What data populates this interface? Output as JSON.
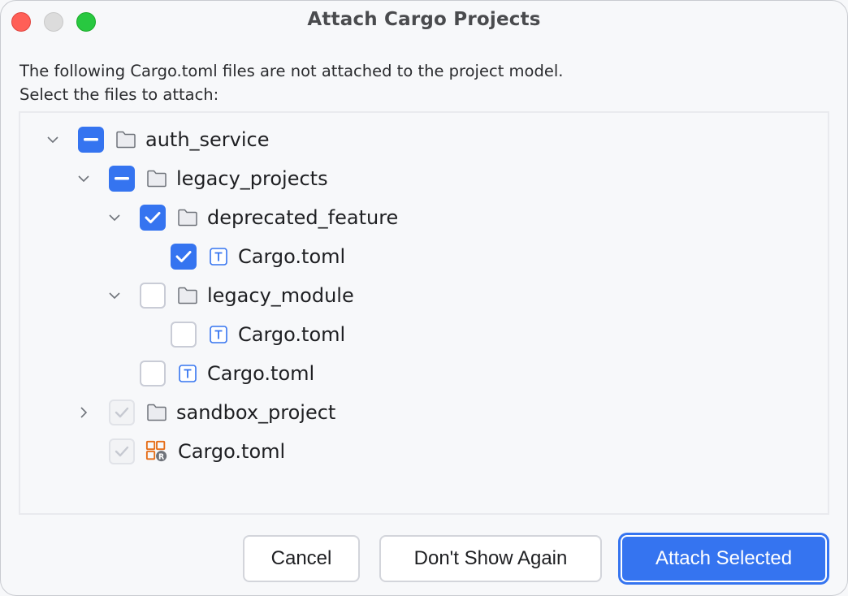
{
  "window": {
    "title": "Attach Cargo Projects",
    "controls": [
      "close",
      "minimize",
      "zoom"
    ]
  },
  "description": {
    "line1": "The following Cargo.toml files are not attached to the project model.",
    "line2": "Select the files to attach:"
  },
  "tree": {
    "items": [
      {
        "label": "auth_service",
        "depth": 0,
        "expander": "expanded",
        "check_state": "partial",
        "icon": "folder-icon"
      },
      {
        "label": "legacy_projects",
        "depth": 1,
        "expander": "expanded",
        "check_state": "partial",
        "icon": "folder-icon"
      },
      {
        "label": "deprecated_feature",
        "depth": 2,
        "expander": "expanded",
        "check_state": "checked",
        "icon": "folder-icon"
      },
      {
        "label": "Cargo.toml",
        "depth": 3,
        "expander": "none",
        "check_state": "checked",
        "icon": "toml-file-icon"
      },
      {
        "label": "legacy_module",
        "depth": 2,
        "expander": "expanded",
        "check_state": "unchecked",
        "icon": "folder-icon"
      },
      {
        "label": "Cargo.toml",
        "depth": 3,
        "expander": "none",
        "check_state": "unchecked",
        "icon": "toml-file-icon"
      },
      {
        "label": "Cargo.toml",
        "depth": 2,
        "expander": "none",
        "check_state": "unchecked",
        "icon": "toml-file-icon"
      },
      {
        "label": "sandbox_project",
        "depth": 1,
        "expander": "collapsed",
        "check_state": "checked-disabled",
        "icon": "folder-icon"
      },
      {
        "label": "Cargo.toml",
        "depth": 1,
        "expander": "none",
        "check_state": "checked-disabled",
        "icon": "rust-cargo-icon"
      }
    ]
  },
  "buttons": {
    "cancel": "Cancel",
    "dont_show_again": "Don't Show Again",
    "attach_selected": "Attach Selected"
  },
  "colors": {
    "accent": "#3574f0",
    "toml_icon": "#3574f0",
    "cargo_icon": "#e66d17"
  }
}
